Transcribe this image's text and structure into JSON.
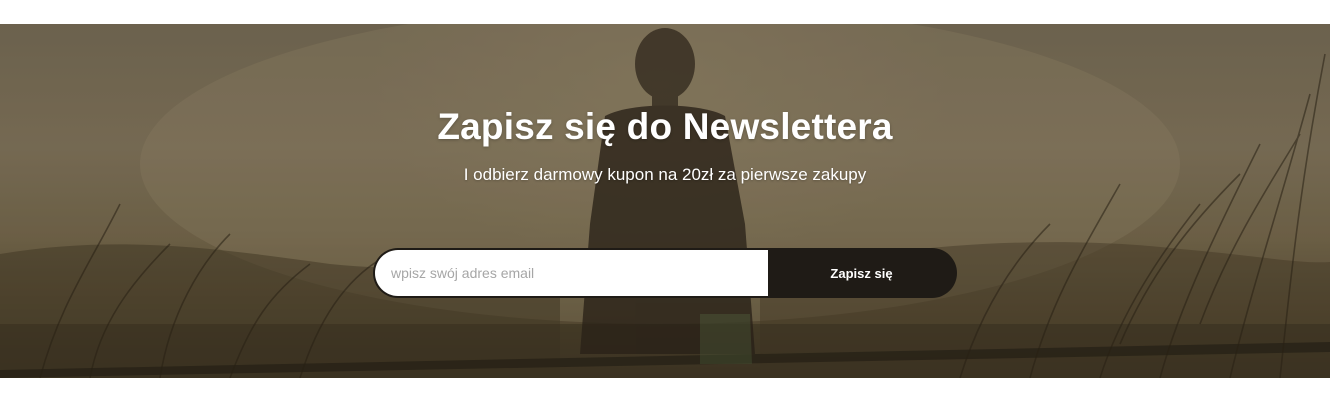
{
  "newsletter": {
    "title": "Zapisz się do Newslettera",
    "subtitle": "I odbierz darmowy kupon na 20zł za pierwsze zakupy",
    "email_placeholder": "wpisz swój adres email",
    "submit_label": "Zapisz się"
  },
  "colors": {
    "button_bg": "#1f1b16",
    "input_bg": "#ffffff",
    "text": "#ffffff"
  }
}
